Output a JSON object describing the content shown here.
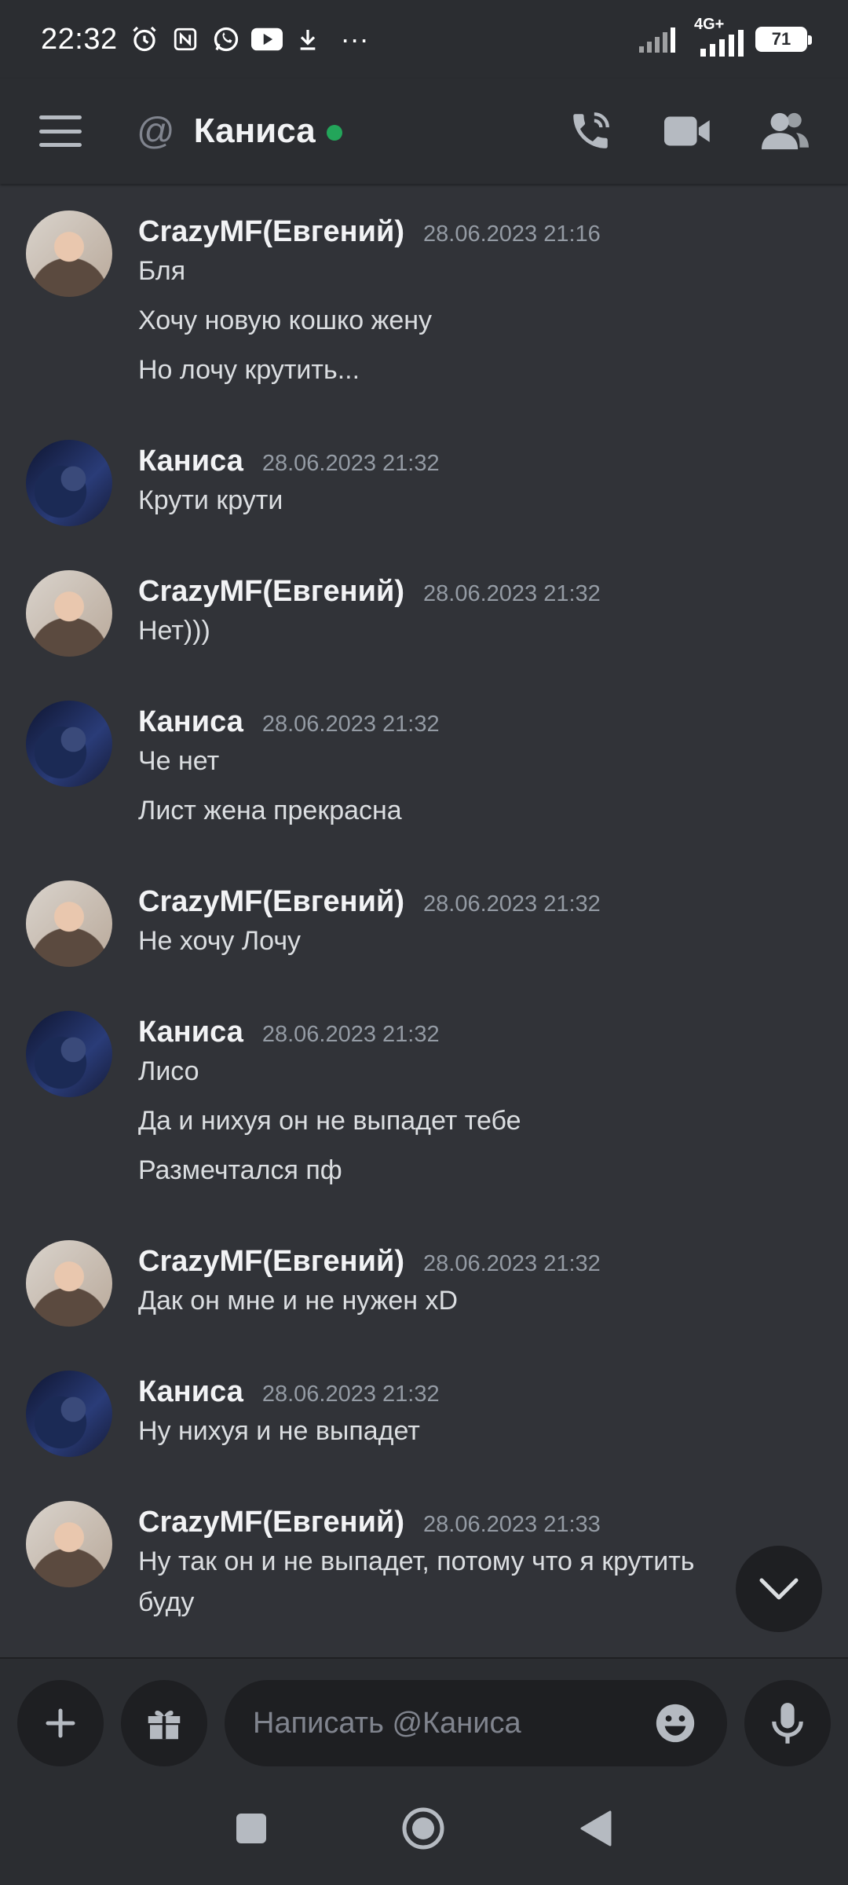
{
  "status_bar": {
    "time": "22:32",
    "network": "4G+",
    "battery": "71",
    "more": "···"
  },
  "header": {
    "title": "Каниса",
    "at_symbol": "@",
    "online_color": "#23a55a",
    "icons": [
      "menu-icon",
      "at-icon",
      "voice-call-icon",
      "video-call-icon",
      "members-icon"
    ]
  },
  "messages": [
    {
      "author": "CrazyMF(Евгений)",
      "timestamp": "28.06.2023 21:16",
      "avatar": "avatar-crazymf",
      "lines": [
        "Бля",
        "Хочу новую кошко жену",
        "Но лочу крутить..."
      ]
    },
    {
      "author": "Каниса",
      "timestamp": "28.06.2023 21:32",
      "avatar": "avatar-kanisa",
      "lines": [
        "Крути крути"
      ]
    },
    {
      "author": "CrazyMF(Евгений)",
      "timestamp": "28.06.2023 21:32",
      "avatar": "avatar-crazymf",
      "lines": [
        "Нет)))"
      ]
    },
    {
      "author": "Каниса",
      "timestamp": "28.06.2023 21:32",
      "avatar": "avatar-kanisa",
      "lines": [
        "Че нет",
        "Лист жена прекрасна"
      ]
    },
    {
      "author": "CrazyMF(Евгений)",
      "timestamp": "28.06.2023 21:32",
      "avatar": "avatar-crazymf",
      "lines": [
        "Не хочу Лочу"
      ]
    },
    {
      "author": "Каниса",
      "timestamp": "28.06.2023 21:32",
      "avatar": "avatar-kanisa",
      "lines": [
        "Лисо",
        "Да и нихуя он не выпадет тебе",
        "Размечтался пф"
      ]
    },
    {
      "author": "CrazyMF(Евгений)",
      "timestamp": "28.06.2023 21:32",
      "avatar": "avatar-crazymf",
      "lines": [
        "Дак он мне и не нужен xD"
      ]
    },
    {
      "author": "Каниса",
      "timestamp": "28.06.2023 21:32",
      "avatar": "avatar-kanisa",
      "lines": [
        "Ну нихуя и не выпадет"
      ]
    },
    {
      "author": "CrazyMF(Евгений)",
      "timestamp": "28.06.2023 21:33",
      "avatar": "avatar-crazymf",
      "lines": [
        "Ну так он и не выпадет, потому что я крутить",
        "буду"
      ]
    }
  ],
  "composer": {
    "placeholder": "Написать @Каниса",
    "value": ""
  },
  "colors": {
    "background": "#313338",
    "header": "#2b2d31",
    "input": "#1e1f22",
    "text": "#dbdee1",
    "muted": "#949ba4"
  }
}
